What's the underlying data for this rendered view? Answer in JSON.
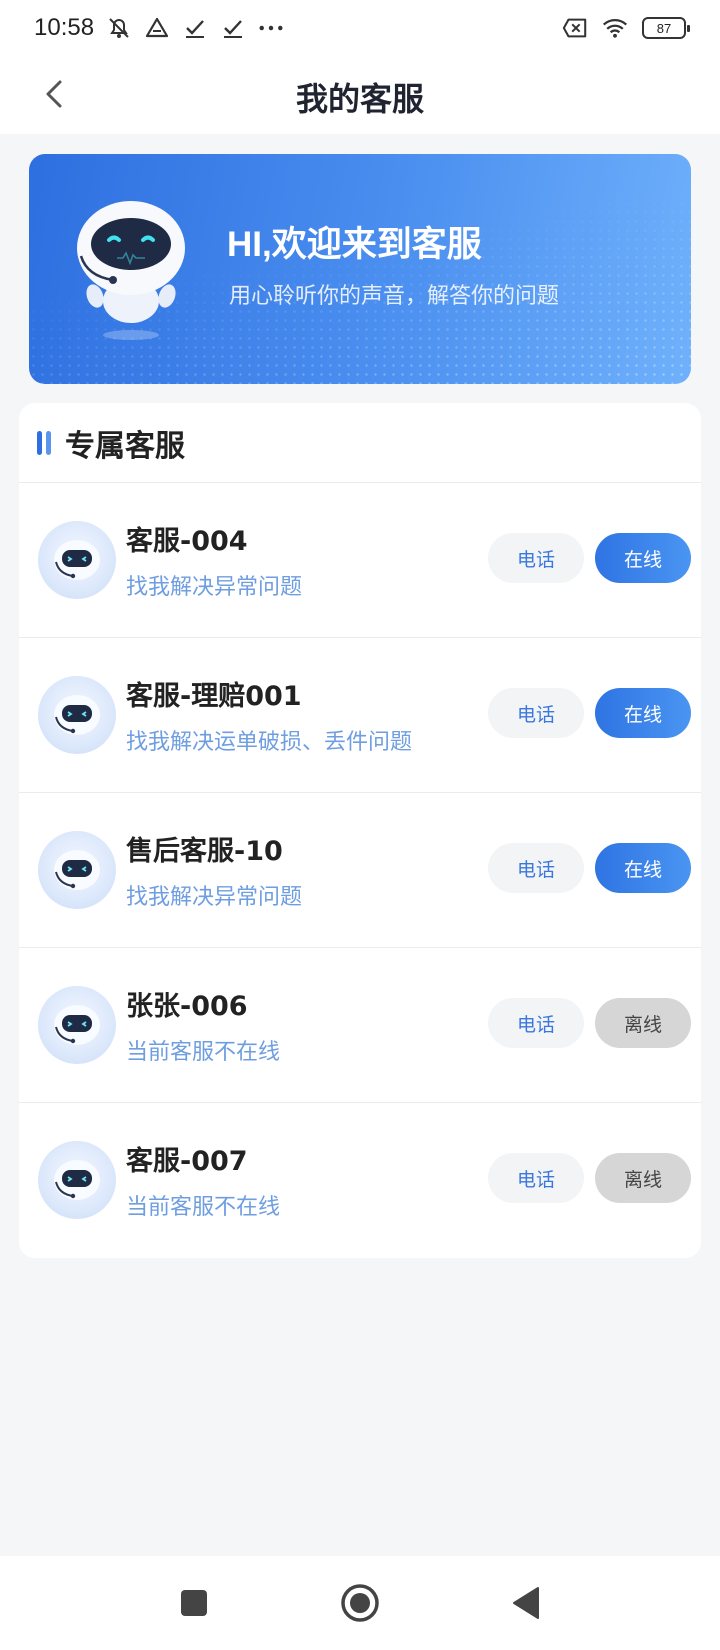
{
  "status_bar": {
    "time": "10:58",
    "battery": "87",
    "left_icons": [
      "mute-bell-icon",
      "drive-icon",
      "check-icon",
      "check-icon",
      "more-dots-icon"
    ],
    "right_icons": [
      "sim-x-icon",
      "wifi-icon",
      "battery-icon"
    ]
  },
  "header": {
    "title": "我的客服",
    "back_icon": "chevron-left-icon"
  },
  "banner": {
    "title": "HI,欢迎来到客服",
    "subtitle": "用心聆听你的声音，解答你的问题"
  },
  "section": {
    "title": "专属客服"
  },
  "agents": [
    {
      "name": "客服-004",
      "desc": "找我解决异常问题",
      "phone_label": "电话",
      "status_label": "在线",
      "status": "online"
    },
    {
      "name": "客服-理赔001",
      "desc": "找我解决运单破损、丢件问题",
      "phone_label": "电话",
      "status_label": "在线",
      "status": "online"
    },
    {
      "name": "售后客服-10",
      "desc": "找我解决异常问题",
      "phone_label": "电话",
      "status_label": "在线",
      "status": "online"
    },
    {
      "name": "张张-006",
      "desc": "当前客服不在线",
      "phone_label": "电话",
      "status_label": "离线",
      "status": "offline"
    },
    {
      "name": "客服-007",
      "desc": "当前客服不在线",
      "phone_label": "电话",
      "status_label": "离线",
      "status": "offline"
    }
  ],
  "colors": {
    "accent": "#2f74e3",
    "desc_text": "#6f9ee0",
    "offline_bg": "#d6d6d6"
  }
}
